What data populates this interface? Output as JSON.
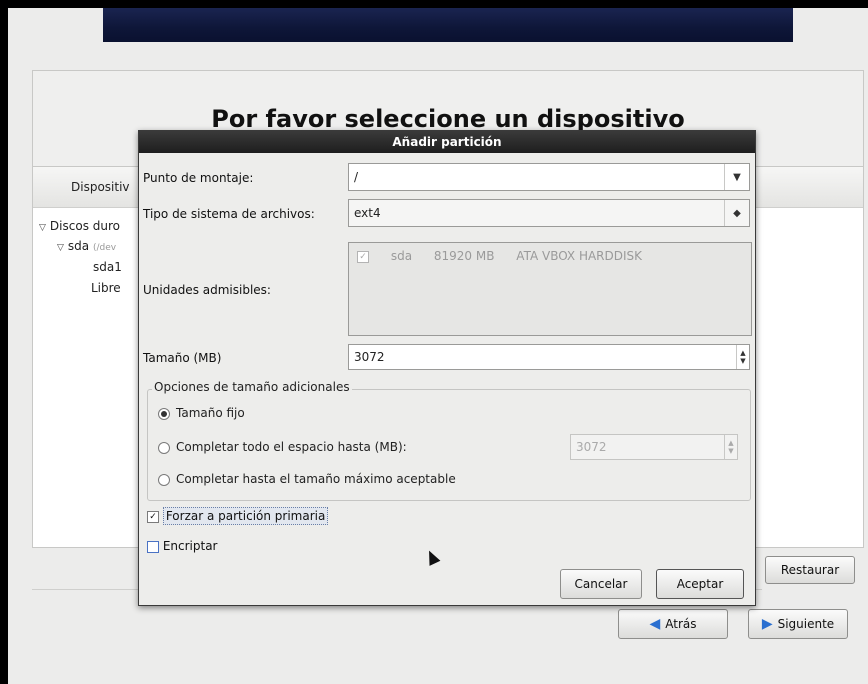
{
  "header": {
    "page_title": "Por favor seleccione un dispositivo"
  },
  "device_panel": {
    "column_header": "Dispositiv",
    "tree": [
      {
        "label": "Discos duro",
        "level": 0,
        "expanded": true
      },
      {
        "label": "sda",
        "sub": "(/dev",
        "level": 1,
        "expanded": true
      },
      {
        "label": "sda1",
        "level": 2
      },
      {
        "label": "Libre",
        "level": 2
      }
    ]
  },
  "buttons": {
    "restore": "Restaurar",
    "back": "Atrás",
    "next": "Siguiente"
  },
  "dialog": {
    "title": "Añadir partición",
    "mount_point": {
      "label": "Punto de montaje:",
      "value": "/"
    },
    "fs_type": {
      "label": "Tipo de sistema de archivos:",
      "value": "ext4"
    },
    "drives": {
      "label": "Unidades admisibles:",
      "rows": [
        {
          "checked": true,
          "name": "sda",
          "size": "81920 MB",
          "model": "ATA VBOX HARDDISK"
        }
      ]
    },
    "size": {
      "label": "Tamaño (MB)",
      "value": "3072"
    },
    "size_options": {
      "legend": "Opciones de tamaño adicionales",
      "fixed": "Tamaño fijo",
      "fill_upto": "Completar todo el espacio hasta (MB):",
      "fill_upto_value": "3072",
      "fill_max": "Completar hasta el tamaño máximo aceptable",
      "selected": "fixed"
    },
    "force_primary": {
      "label": "Forzar a partición primaria",
      "checked": true
    },
    "encrypt": {
      "label": "Encriptar",
      "checked": false
    },
    "cancel": "Cancelar",
    "accept": "Aceptar"
  }
}
